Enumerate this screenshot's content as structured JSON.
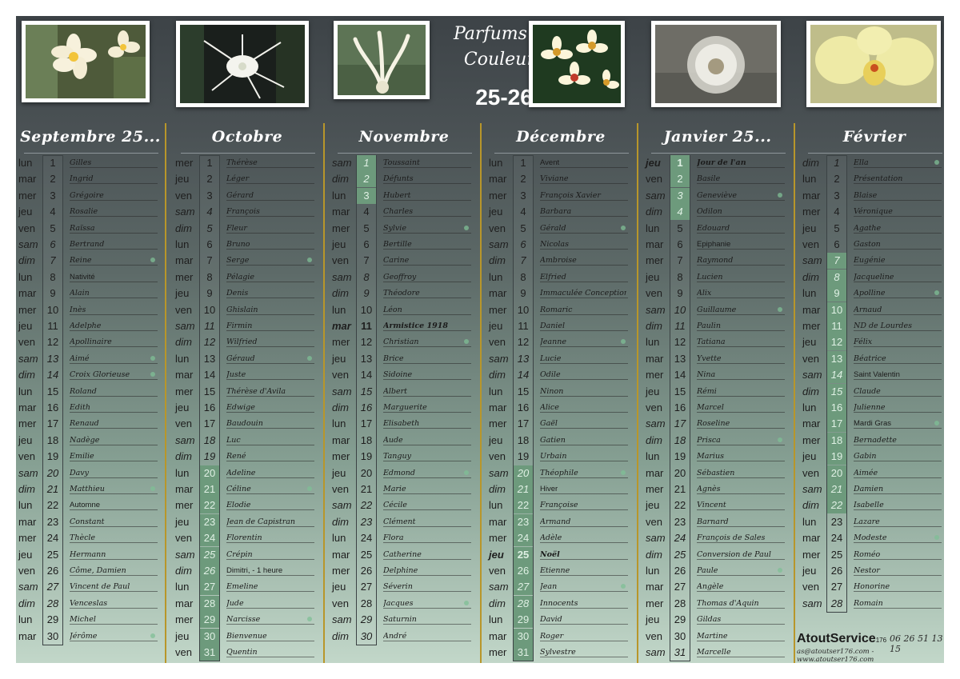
{
  "title": {
    "line1": "Parfums de",
    "line2": "Couleurs",
    "year": "25-26"
  },
  "brand": {
    "name": "AtoutService",
    "sub": "176",
    "phone": "06 26 51 13 15",
    "contact": "as@atoutser176.com - www.atoutser176.com"
  },
  "months": [
    {
      "name": "Septembre 25...",
      "days": [
        {
          "n": "1",
          "d": "lun",
          "s": "Gilles"
        },
        {
          "n": "2",
          "d": "mar",
          "s": "Ingrid"
        },
        {
          "n": "3",
          "d": "mer",
          "s": "Grégoire"
        },
        {
          "n": "4",
          "d": "jeu",
          "s": "Rosalie"
        },
        {
          "n": "5",
          "d": "ven",
          "s": "Raïssa"
        },
        {
          "n": "6",
          "d": "sam",
          "s": "Bertrand"
        },
        {
          "n": "7",
          "d": "dim",
          "s": "Reine"
        },
        {
          "n": "8",
          "d": "lun",
          "s": "Nativité"
        },
        {
          "n": "9",
          "d": "mar",
          "s": "Alain"
        },
        {
          "n": "10",
          "d": "mer",
          "s": "Inès"
        },
        {
          "n": "11",
          "d": "jeu",
          "s": "Adelphe"
        },
        {
          "n": "12",
          "d": "ven",
          "s": "Apollinaire"
        },
        {
          "n": "13",
          "d": "sam",
          "s": "Aimé"
        },
        {
          "n": "14",
          "d": "dim",
          "s": "Croix Glorieuse"
        },
        {
          "n": "15",
          "d": "lun",
          "s": "Roland"
        },
        {
          "n": "16",
          "d": "mar",
          "s": "Edith"
        },
        {
          "n": "17",
          "d": "mer",
          "s": "Renaud"
        },
        {
          "n": "18",
          "d": "jeu",
          "s": "Nadège"
        },
        {
          "n": "19",
          "d": "ven",
          "s": "Emilie"
        },
        {
          "n": "20",
          "d": "sam",
          "s": "Davy"
        },
        {
          "n": "21",
          "d": "dim",
          "s": "Matthieu"
        },
        {
          "n": "22",
          "d": "lun",
          "s": "Automne"
        },
        {
          "n": "23",
          "d": "mar",
          "s": "Constant"
        },
        {
          "n": "24",
          "d": "mer",
          "s": "Thècle"
        },
        {
          "n": "25",
          "d": "jeu",
          "s": "Hermann"
        },
        {
          "n": "26",
          "d": "ven",
          "s": "Côme, Damien"
        },
        {
          "n": "27",
          "d": "sam",
          "s": "Vincent de Paul"
        },
        {
          "n": "28",
          "d": "dim",
          "s": "Venceslas"
        },
        {
          "n": "29",
          "d": "lun",
          "s": "Michel"
        },
        {
          "n": "30",
          "d": "mar",
          "s": "Jérôme"
        }
      ]
    },
    {
      "name": "Octobre",
      "days": [
        {
          "n": "1",
          "d": "mer",
          "s": "Thérèse"
        },
        {
          "n": "2",
          "d": "jeu",
          "s": "Léger"
        },
        {
          "n": "3",
          "d": "ven",
          "s": "Gérard"
        },
        {
          "n": "4",
          "d": "sam",
          "s": "François"
        },
        {
          "n": "5",
          "d": "dim",
          "s": "Fleur"
        },
        {
          "n": "6",
          "d": "lun",
          "s": "Bruno"
        },
        {
          "n": "7",
          "d": "mar",
          "s": "Serge"
        },
        {
          "n": "8",
          "d": "mer",
          "s": "Pélagie"
        },
        {
          "n": "9",
          "d": "jeu",
          "s": "Denis"
        },
        {
          "n": "10",
          "d": "ven",
          "s": "Ghislain"
        },
        {
          "n": "11",
          "d": "sam",
          "s": "Firmin"
        },
        {
          "n": "12",
          "d": "dim",
          "s": "Wilfried"
        },
        {
          "n": "13",
          "d": "lun",
          "s": "Géraud"
        },
        {
          "n": "14",
          "d": "mar",
          "s": "Juste"
        },
        {
          "n": "15",
          "d": "mer",
          "s": "Thérèse d'Avila"
        },
        {
          "n": "16",
          "d": "jeu",
          "s": "Edwige"
        },
        {
          "n": "17",
          "d": "ven",
          "s": "Baudouin"
        },
        {
          "n": "18",
          "d": "sam",
          "s": "Luc"
        },
        {
          "n": "19",
          "d": "dim",
          "s": "René"
        },
        {
          "n": "20",
          "d": "lun",
          "s": "Adeline"
        },
        {
          "n": "21",
          "d": "mar",
          "s": "Céline"
        },
        {
          "n": "22",
          "d": "mer",
          "s": "Elodie"
        },
        {
          "n": "23",
          "d": "jeu",
          "s": "Jean de Capistran"
        },
        {
          "n": "24",
          "d": "ven",
          "s": "Florentin"
        },
        {
          "n": "25",
          "d": "sam",
          "s": "Crépin"
        },
        {
          "n": "26",
          "d": "dim",
          "s": "Dimitri, - 1 heure"
        },
        {
          "n": "27",
          "d": "lun",
          "s": "Emeline"
        },
        {
          "n": "28",
          "d": "mar",
          "s": "Jude"
        },
        {
          "n": "29",
          "d": "mer",
          "s": "Narcisse"
        },
        {
          "n": "30",
          "d": "jeu",
          "s": "Bienvenue"
        },
        {
          "n": "31",
          "d": "ven",
          "s": "Quentin"
        }
      ]
    },
    {
      "name": "Novembre",
      "days": [
        {
          "n": "1",
          "d": "sam",
          "s": "Toussaint"
        },
        {
          "n": "2",
          "d": "dim",
          "s": "Défunts"
        },
        {
          "n": "3",
          "d": "lun",
          "s": "Hubert"
        },
        {
          "n": "4",
          "d": "mar",
          "s": "Charles"
        },
        {
          "n": "5",
          "d": "mer",
          "s": "Sylvie"
        },
        {
          "n": "6",
          "d": "jeu",
          "s": "Bertille"
        },
        {
          "n": "7",
          "d": "ven",
          "s": "Carine"
        },
        {
          "n": "8",
          "d": "sam",
          "s": "Geoffroy"
        },
        {
          "n": "9",
          "d": "dim",
          "s": "Théodore"
        },
        {
          "n": "10",
          "d": "lun",
          "s": "Léon"
        },
        {
          "n": "11",
          "d": "mar",
          "s": "Armistice 1918"
        },
        {
          "n": "12",
          "d": "mer",
          "s": "Christian"
        },
        {
          "n": "13",
          "d": "jeu",
          "s": "Brice"
        },
        {
          "n": "14",
          "d": "ven",
          "s": "Sidoine"
        },
        {
          "n": "15",
          "d": "sam",
          "s": "Albert"
        },
        {
          "n": "16",
          "d": "dim",
          "s": "Marguerite"
        },
        {
          "n": "17",
          "d": "lun",
          "s": "Elisabeth"
        },
        {
          "n": "18",
          "d": "mar",
          "s": "Aude"
        },
        {
          "n": "19",
          "d": "mer",
          "s": "Tanguy"
        },
        {
          "n": "20",
          "d": "jeu",
          "s": "Edmond"
        },
        {
          "n": "21",
          "d": "ven",
          "s": "Marie"
        },
        {
          "n": "22",
          "d": "sam",
          "s": "Cécile"
        },
        {
          "n": "23",
          "d": "dim",
          "s": "Clément"
        },
        {
          "n": "24",
          "d": "lun",
          "s": "Flora"
        },
        {
          "n": "25",
          "d": "mar",
          "s": "Catherine"
        },
        {
          "n": "26",
          "d": "mer",
          "s": "Delphine"
        },
        {
          "n": "27",
          "d": "jeu",
          "s": "Séverin"
        },
        {
          "n": "28",
          "d": "ven",
          "s": "Jacques"
        },
        {
          "n": "29",
          "d": "sam",
          "s": "Saturnin"
        },
        {
          "n": "30",
          "d": "dim",
          "s": "André"
        }
      ]
    },
    {
      "name": "Décembre",
      "days": [
        {
          "n": "1",
          "d": "lun",
          "s": "Avent"
        },
        {
          "n": "2",
          "d": "mar",
          "s": "Viviane"
        },
        {
          "n": "3",
          "d": "mer",
          "s": "François Xavier"
        },
        {
          "n": "4",
          "d": "jeu",
          "s": "Barbara"
        },
        {
          "n": "5",
          "d": "ven",
          "s": "Gérald"
        },
        {
          "n": "6",
          "d": "sam",
          "s": "Nicolas"
        },
        {
          "n": "7",
          "d": "dim",
          "s": "Ambroise"
        },
        {
          "n": "8",
          "d": "lun",
          "s": "Elfried"
        },
        {
          "n": "9",
          "d": "mar",
          "s": "Immaculée Conception"
        },
        {
          "n": "10",
          "d": "mer",
          "s": "Romaric"
        },
        {
          "n": "11",
          "d": "jeu",
          "s": "Daniel"
        },
        {
          "n": "12",
          "d": "ven",
          "s": "Jeanne"
        },
        {
          "n": "13",
          "d": "sam",
          "s": "Lucie"
        },
        {
          "n": "14",
          "d": "dim",
          "s": "Odile"
        },
        {
          "n": "15",
          "d": "lun",
          "s": "Ninon"
        },
        {
          "n": "16",
          "d": "mar",
          "s": "Alice"
        },
        {
          "n": "17",
          "d": "mer",
          "s": "Gaël"
        },
        {
          "n": "18",
          "d": "jeu",
          "s": "Gatien"
        },
        {
          "n": "19",
          "d": "ven",
          "s": "Urbain"
        },
        {
          "n": "20",
          "d": "sam",
          "s": "Théophile"
        },
        {
          "n": "21",
          "d": "dim",
          "s": "Hiver"
        },
        {
          "n": "22",
          "d": "lun",
          "s": "Françoise"
        },
        {
          "n": "23",
          "d": "mar",
          "s": "Armand"
        },
        {
          "n": "24",
          "d": "mer",
          "s": "Adèle"
        },
        {
          "n": "25",
          "d": "jeu",
          "s": "Noël"
        },
        {
          "n": "26",
          "d": "ven",
          "s": "Etienne"
        },
        {
          "n": "27",
          "d": "sam",
          "s": "Jean"
        },
        {
          "n": "28",
          "d": "dim",
          "s": "Innocents"
        },
        {
          "n": "29",
          "d": "lun",
          "s": "David"
        },
        {
          "n": "30",
          "d": "mar",
          "s": "Roger"
        },
        {
          "n": "31",
          "d": "mer",
          "s": "Sylvestre"
        }
      ]
    },
    {
      "name": "Janvier 25...",
      "days": [
        {
          "n": "1",
          "d": "jeu",
          "s": "Jour de l'an"
        },
        {
          "n": "2",
          "d": "ven",
          "s": "Basile"
        },
        {
          "n": "3",
          "d": "sam",
          "s": "Geneviève"
        },
        {
          "n": "4",
          "d": "dim",
          "s": "Odilon"
        },
        {
          "n": "5",
          "d": "lun",
          "s": "Edouard"
        },
        {
          "n": "6",
          "d": "mar",
          "s": "Epiphanie"
        },
        {
          "n": "7",
          "d": "mer",
          "s": "Raymond"
        },
        {
          "n": "8",
          "d": "jeu",
          "s": "Lucien"
        },
        {
          "n": "9",
          "d": "ven",
          "s": "Alix"
        },
        {
          "n": "10",
          "d": "sam",
          "s": "Guillaume"
        },
        {
          "n": "11",
          "d": "dim",
          "s": "Paulin"
        },
        {
          "n": "12",
          "d": "lun",
          "s": "Tatiana"
        },
        {
          "n": "13",
          "d": "mar",
          "s": "Yvette"
        },
        {
          "n": "14",
          "d": "mer",
          "s": "Nina"
        },
        {
          "n": "15",
          "d": "jeu",
          "s": "Rémi"
        },
        {
          "n": "16",
          "d": "ven",
          "s": "Marcel"
        },
        {
          "n": "17",
          "d": "sam",
          "s": "Roseline"
        },
        {
          "n": "18",
          "d": "dim",
          "s": "Prisca"
        },
        {
          "n": "19",
          "d": "lun",
          "s": "Marius"
        },
        {
          "n": "20",
          "d": "mar",
          "s": "Sébastien"
        },
        {
          "n": "21",
          "d": "mer",
          "s": "Agnès"
        },
        {
          "n": "22",
          "d": "jeu",
          "s": "Vincent"
        },
        {
          "n": "23",
          "d": "ven",
          "s": "Barnard"
        },
        {
          "n": "24",
          "d": "sam",
          "s": "François de Sales"
        },
        {
          "n": "25",
          "d": "dim",
          "s": "Conversion de Paul"
        },
        {
          "n": "26",
          "d": "lun",
          "s": "Paule"
        },
        {
          "n": "27",
          "d": "mar",
          "s": "Angèle"
        },
        {
          "n": "28",
          "d": "mer",
          "s": "Thomas d'Aquin"
        },
        {
          "n": "29",
          "d": "jeu",
          "s": "Gildas"
        },
        {
          "n": "30",
          "d": "ven",
          "s": "Martine"
        },
        {
          "n": "31",
          "d": "sam",
          "s": "Marcelle"
        }
      ]
    },
    {
      "name": "Février",
      "days": [
        {
          "n": "1",
          "d": "dim",
          "s": "Ella"
        },
        {
          "n": "2",
          "d": "lun",
          "s": "Présentation"
        },
        {
          "n": "3",
          "d": "mar",
          "s": "Blaise"
        },
        {
          "n": "4",
          "d": "mer",
          "s": "Véronique"
        },
        {
          "n": "5",
          "d": "jeu",
          "s": "Agathe"
        },
        {
          "n": "6",
          "d": "ven",
          "s": "Gaston"
        },
        {
          "n": "7",
          "d": "sam",
          "s": "Eugénie"
        },
        {
          "n": "8",
          "d": "dim",
          "s": "Jacqueline"
        },
        {
          "n": "9",
          "d": "lun",
          "s": "Apolline"
        },
        {
          "n": "10",
          "d": "mar",
          "s": "Arnaud"
        },
        {
          "n": "11",
          "d": "mer",
          "s": "ND de Lourdes"
        },
        {
          "n": "12",
          "d": "jeu",
          "s": "Félix"
        },
        {
          "n": "13",
          "d": "ven",
          "s": "Béatrice"
        },
        {
          "n": "14",
          "d": "sam",
          "s": "Saint Valentin"
        },
        {
          "n": "15",
          "d": "dim",
          "s": "Claude"
        },
        {
          "n": "16",
          "d": "lun",
          "s": "Julienne"
        },
        {
          "n": "17",
          "d": "mar",
          "s": "Mardi Gras"
        },
        {
          "n": "18",
          "d": "mer",
          "s": "Bernadette"
        },
        {
          "n": "19",
          "d": "jeu",
          "s": "Gabin"
        },
        {
          "n": "20",
          "d": "ven",
          "s": "Aimée"
        },
        {
          "n": "21",
          "d": "sam",
          "s": "Damien"
        },
        {
          "n": "22",
          "d": "dim",
          "s": "Isabelle"
        },
        {
          "n": "23",
          "d": "lun",
          "s": "Lazare"
        },
        {
          "n": "24",
          "d": "mar",
          "s": "Modeste"
        },
        {
          "n": "25",
          "d": "mer",
          "s": "Roméo"
        },
        {
          "n": "26",
          "d": "jeu",
          "s": "Nestor"
        },
        {
          "n": "27",
          "d": "ven",
          "s": "Honorine"
        },
        {
          "n": "28",
          "d": "sam",
          "s": "Romain"
        }
      ]
    }
  ],
  "highlights": {
    "0": [],
    "1": [
      20,
      21,
      22,
      23,
      24,
      25,
      26,
      27,
      28,
      29,
      30,
      31
    ],
    "2": [
      1,
      2,
      3
    ],
    "3": [
      20,
      21,
      22,
      23,
      24,
      25,
      26,
      27,
      28,
      29,
      30,
      31
    ],
    "4": [
      1,
      2,
      3,
      4
    ],
    "5": [
      7,
      8,
      9,
      10,
      11,
      12,
      13,
      14,
      15,
      16,
      17,
      18,
      19,
      20,
      21,
      22
    ]
  },
  "holidays": {
    "2": [
      11
    ],
    "3": [
      25
    ],
    "4": [
      1
    ]
  },
  "plain_text_days": {
    "0": [
      8,
      22
    ],
    "3": [
      1,
      21
    ],
    "4": [
      6
    ],
    "5": [
      14,
      17
    ],
    "1": [
      26
    ]
  },
  "moons": {
    "0": [
      7,
      13,
      14,
      21,
      30
    ],
    "1": [
      7,
      13,
      21,
      29
    ],
    "2": [
      5,
      12,
      20,
      28
    ],
    "3": [
      5,
      12,
      20,
      27
    ],
    "4": [
      3,
      10,
      18,
      26
    ],
    "5": [
      1,
      9,
      17,
      24
    ]
  }
}
